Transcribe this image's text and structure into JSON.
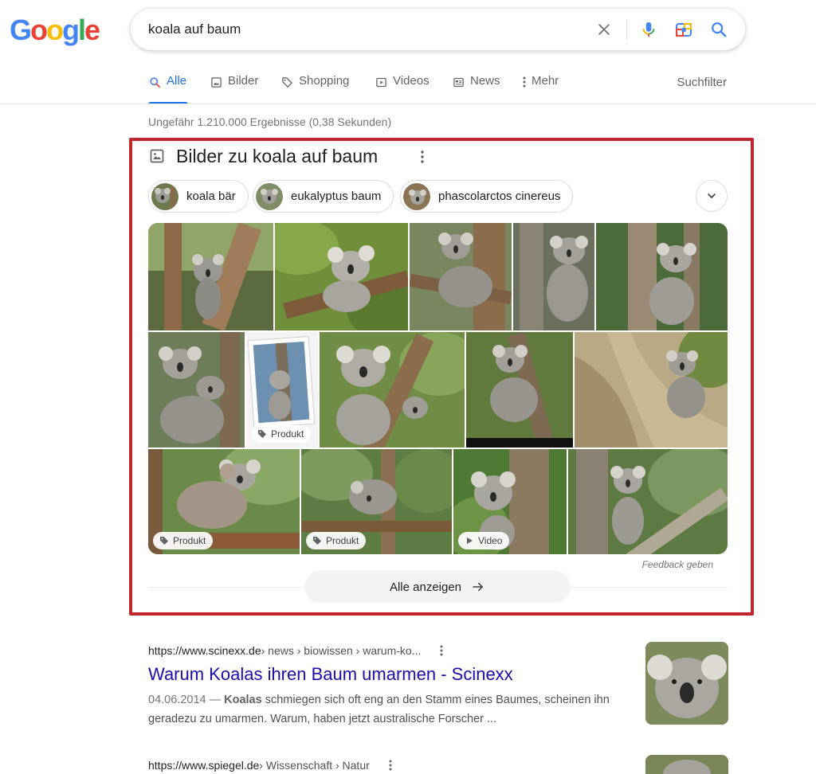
{
  "logo": {
    "letters": [
      "G",
      "o",
      "o",
      "g",
      "l",
      "e"
    ],
    "colors": [
      "#4285f4",
      "#ea4335",
      "#fbbc05",
      "#4285f4",
      "#34a853",
      "#ea4335"
    ]
  },
  "search": {
    "query": "koala auf baum",
    "placeholder": ""
  },
  "tabs": [
    {
      "label": "Alle",
      "icon": "search-icon",
      "active": true
    },
    {
      "label": "Bilder",
      "icon": "image-icon",
      "active": false
    },
    {
      "label": "Shopping",
      "icon": "tag-icon",
      "active": false
    },
    {
      "label": "Videos",
      "icon": "play-icon",
      "active": false
    },
    {
      "label": "News",
      "icon": "news-icon",
      "active": false
    },
    {
      "label": "Mehr",
      "icon": "more-vert-icon",
      "active": false
    }
  ],
  "tools_label": "Suchfilter",
  "result_stats": "Ungefähr 1.210.000 Ergebnisse (0,38 Sekunden)",
  "images_block": {
    "title": "Bilder zu koala auf baum",
    "chips": [
      {
        "label": "koala bär"
      },
      {
        "label": "eukalyptus baum"
      },
      {
        "label": "phascolarctos cinereus"
      }
    ],
    "badges": {
      "product": "Produkt",
      "video": "Video"
    },
    "feedback": "Feedback geben",
    "show_all": "Alle anzeigen"
  },
  "results": [
    {
      "domain": "https://www.scinexx.de",
      "crumbs": " › news › biowissen › warum-ko...",
      "title": "Warum Koalas ihren Baum umarmen - Scinexx",
      "date": "04.06.2014 —",
      "bold": "Koalas",
      "snippet": " schmiegen sich oft eng an den Stamm eines Baumes, scheinen ihn geradezu zu umarmen. Warum, haben jetzt australische Forscher ..."
    },
    {
      "domain": "https://www.spiegel.de",
      "crumbs": " › Wissenschaft › Natur"
    }
  ],
  "colors": {
    "accent": "#1a73e8",
    "link": "#1a0dab",
    "highlight_border": "#c0272d"
  }
}
